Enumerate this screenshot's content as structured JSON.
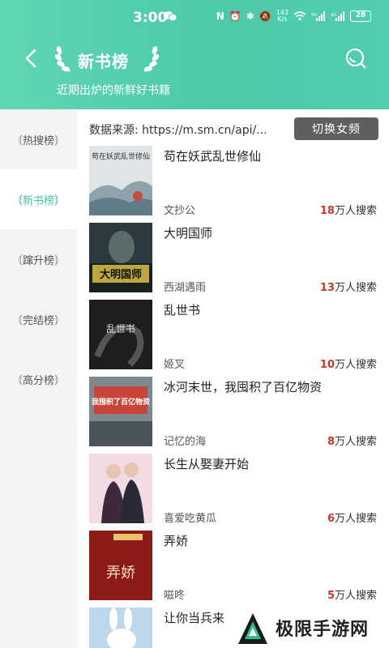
{
  "status_bar": {
    "time": "3:00",
    "net_speed_top": "143",
    "net_speed_unit": "K/s",
    "battery": "28",
    "sig1": "5G",
    "sig2": "4G"
  },
  "header": {
    "back_icon": "chevron-left-icon",
    "title": "新书榜",
    "subtitle": "近期出炉的新鲜好书籍",
    "search_icon": "search-icon"
  },
  "sidebar": {
    "items": [
      {
        "label": "热搜榜",
        "active": false
      },
      {
        "label": "新书榜",
        "active": true
      },
      {
        "label": "蹿升榜",
        "active": false
      },
      {
        "label": "完结榜",
        "active": false
      },
      {
        "label": "高分榜",
        "active": false
      }
    ]
  },
  "content": {
    "source_label": "数据来源:",
    "source_url": "https://m.sm.cn/api/...",
    "switch_button": "切换女频",
    "suffix": "万人搜索"
  },
  "books": [
    {
      "title": "苟在妖武乱世修仙",
      "author": "文抄公",
      "count": "18",
      "cover_text": "苟在妖武乱世修仙"
    },
    {
      "title": "大明国师",
      "author": "西湖遇雨",
      "count": "13",
      "cover_text": "大明国师"
    },
    {
      "title": "乱世书",
      "author": "姬叉",
      "count": "10",
      "cover_text": "乱世书"
    },
    {
      "title": "冰河末世，我囤积了百亿物资",
      "author": "记忆的海",
      "count": "8",
      "cover_text": "我囤积了百亿物资"
    },
    {
      "title": "长生从娶妻开始",
      "author": "喜爱吃黄瓜",
      "count": "6",
      "cover_text": ""
    },
    {
      "title": "弄娇",
      "author": "嗞咚",
      "count": "5",
      "cover_text": "弄娇"
    },
    {
      "title": "让你当兵来",
      "author": "",
      "count": "",
      "cover_text": ""
    }
  ],
  "watermark": {
    "text": "极限手游网"
  }
}
